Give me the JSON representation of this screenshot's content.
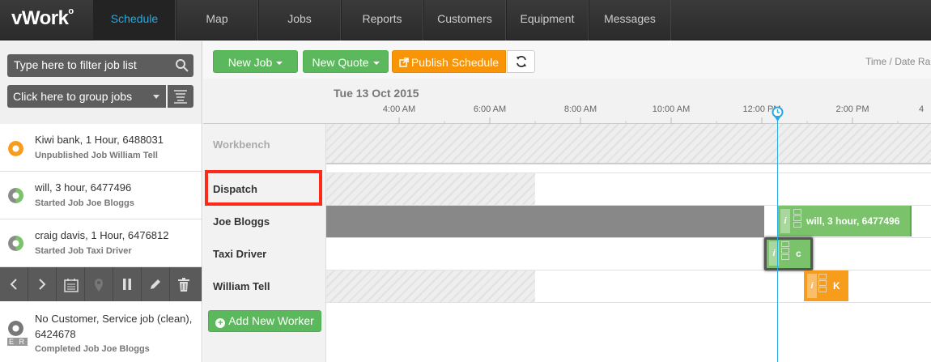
{
  "nav": {
    "logo": "vWork",
    "tabs": [
      "Schedule",
      "Map",
      "Jobs",
      "Reports",
      "Customers",
      "Equipment",
      "Messages"
    ],
    "active": "Schedule"
  },
  "left": {
    "filter_placeholder": "Type here to filter job list",
    "group_label": "Click here to group jobs",
    "jobs": [
      {
        "title": "Kiwi bank, 1 Hour, 6488031",
        "sub": "Unpublished Job William Tell",
        "status_color": "#f89c1c"
      },
      {
        "title": "will, 3 hour, 6477496",
        "sub": "Started Job Joe Bloggs",
        "status_color": "#7ac36a"
      },
      {
        "title": "craig davis, 1 Hour, 6476812",
        "sub": "Started Job Taxi Driver",
        "status_color": "#7ac36a"
      }
    ],
    "completed_job": {
      "title_line1": "No Customer, Service job (clean),",
      "title_line2": "6424678",
      "sub": "Completed Job Joe Bloggs",
      "badge": "E R"
    },
    "toolbar_icons": [
      "chevron-left-icon",
      "chevron-right-icon",
      "calendar-icon",
      "map-pin-icon",
      "pause-icon",
      "pencil-icon",
      "trash-icon"
    ]
  },
  "toolbar": {
    "new_job": "New Job",
    "new_quote": "New Quote",
    "publish": "Publish Schedule",
    "time_range": "Time / Date Ra"
  },
  "timeline": {
    "date": "Tue 13 Oct 2015",
    "ticks": [
      "4:00 AM",
      "6:00 AM",
      "8:00 AM",
      "10:00 AM",
      "12:00 PM",
      "2:00 PM",
      "4"
    ]
  },
  "workers": {
    "workbench": "Workbench",
    "rows": [
      "Dispatch",
      "Joe Bloggs",
      "Taxi Driver",
      "William Tell"
    ],
    "add_worker": "Add New Worker"
  },
  "jobs_on_timeline": {
    "joe": {
      "label": "will, 3 hour, 6477496",
      "info": "i"
    },
    "taxi": {
      "label": "c",
      "info": "i"
    },
    "william": {
      "label": "K",
      "info": "i"
    }
  }
}
